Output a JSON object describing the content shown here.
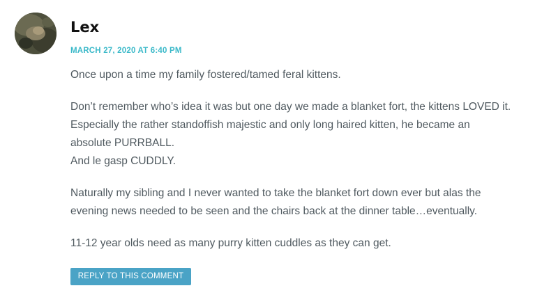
{
  "comment": {
    "author": "Lex",
    "avatar_icon": "user-avatar-photo",
    "date": "MARCH 27, 2020 AT 6:40 PM",
    "paragraphs": [
      [
        "Once upon a time my family fostered/tamed feral kittens."
      ],
      [
        "Don’t remember who’s idea it was but one day we made a blanket fort, the kittens LOVED it.",
        "Especially the rather standoffish majestic and only long haired kitten, he became an",
        "absolute PURRBALL.",
        "And le gasp CUDDLY."
      ],
      [
        "Naturally my sibling and I never wanted to take the blanket fort down ever but alas the",
        "evening news needed to be seen and the chairs back at the dinner table…eventually."
      ],
      [
        "11-12 year olds need as many purry kitten cuddles as they can get."
      ]
    ],
    "reply_label": "REPLY TO THIS COMMENT"
  },
  "colors": {
    "meta": "#3bb9c9",
    "button": "#4aa3c6",
    "text": "#505a60",
    "author": "#111111"
  }
}
